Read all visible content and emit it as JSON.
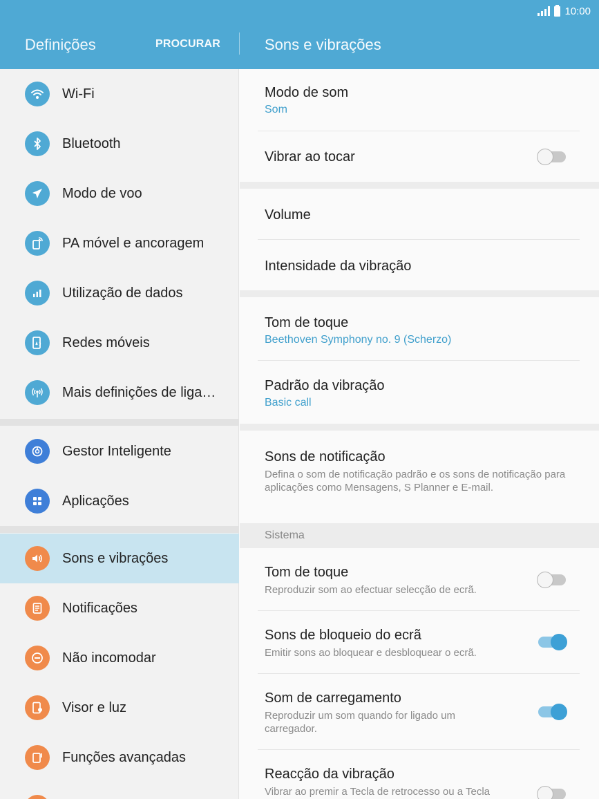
{
  "status_bar": {
    "time": "10:00"
  },
  "header": {
    "title": "Definições",
    "search_label": "PROCURAR",
    "page_title": "Sons e vibrações"
  },
  "sidebar": {
    "items": [
      {
        "label": "Wi-Fi",
        "icon": "wifi-icon"
      },
      {
        "label": "Bluetooth",
        "icon": "bluetooth-icon"
      },
      {
        "label": "Modo de voo",
        "icon": "airplane-icon"
      },
      {
        "label": "PA móvel e ancoragem",
        "icon": "hotspot-icon"
      },
      {
        "label": "Utilização de dados",
        "icon": "data-usage-icon"
      },
      {
        "label": "Redes móveis",
        "icon": "mobile-networks-icon"
      },
      {
        "label": "Mais definições de liga…",
        "icon": "more-connections-icon"
      },
      {
        "label": "Gestor Inteligente",
        "icon": "smart-manager-icon"
      },
      {
        "label": "Aplicações",
        "icon": "apps-icon"
      },
      {
        "label": "Sons e vibrações",
        "icon": "speaker-icon",
        "active": true
      },
      {
        "label": "Notificações",
        "icon": "notifications-icon"
      },
      {
        "label": "Não incomodar",
        "icon": "do-not-disturb-icon"
      },
      {
        "label": "Visor e luz",
        "icon": "display-icon"
      },
      {
        "label": "Funções avançadas",
        "icon": "advanced-features-icon"
      }
    ]
  },
  "main": {
    "sound_mode": {
      "title": "Modo de som",
      "value": "Som"
    },
    "vibrate_on_ring": {
      "title": "Vibrar ao tocar",
      "enabled": false
    },
    "volume": {
      "title": "Volume"
    },
    "vibration_intensity": {
      "title": "Intensidade da vibração"
    },
    "ringtone": {
      "title": "Tom de toque",
      "value": "Beethoven Symphony no. 9 (Scherzo)"
    },
    "vibration_pattern": {
      "title": "Padrão da vibração",
      "value": "Basic call"
    },
    "notification_sounds": {
      "title": "Sons de notificação",
      "description": "Defina o som de notificação padrão e os sons de notificação para aplicações como Mensagens, S Planner e E-mail."
    },
    "system_section": {
      "label": "Sistema"
    },
    "touch_sounds": {
      "title": "Tom de toque",
      "description": "Reproduzir som ao efectuar selecção de ecrã.",
      "enabled": false
    },
    "lock_sounds": {
      "title": "Sons de bloqueio do ecrã",
      "description": "Emitir sons ao bloquear e desbloquear o ecrã.",
      "enabled": true
    },
    "charging_sound": {
      "title": "Som de carregamento",
      "description": "Reproduzir um som quando for ligado um carregador.",
      "enabled": true
    },
    "vibration_feedback": {
      "title": "Reacção da vibração",
      "description": "Vibrar ao premir a Tecla de retrocesso ou a Tecla",
      "enabled": false
    }
  },
  "colors": {
    "header": "#4fa9d4",
    "accent": "#3f9fcc",
    "active_item": "#c8e4f0",
    "icon_blue": "#4fa9d4",
    "icon_orange": "#f08a4b"
  }
}
